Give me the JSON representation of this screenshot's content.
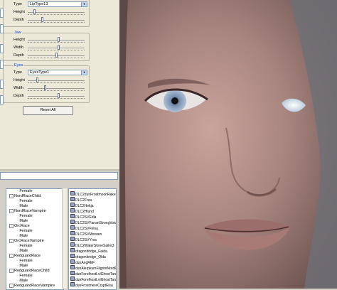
{
  "lips": {
    "type_label": "Type",
    "type_value": "LipType13",
    "height_label": "Height",
    "depth_label": "Depth",
    "height_level": 0.1,
    "depth_level": 0.25
  },
  "jaw": {
    "title": "Jaw",
    "height_label": "Height",
    "width_label": "Width",
    "depth_label": "Depth",
    "height_level": 0.55,
    "width_level": 0.55,
    "depth_level": 0.5
  },
  "eyes": {
    "title": "Eyes",
    "type_label": "Type",
    "type_value": "EyesType1",
    "height_label": "Height",
    "width_label": "Width",
    "depth_label": "Depth",
    "height_level": 0.15,
    "width_level": 0.3,
    "depth_level": 0.55
  },
  "reset_label": "Reset All",
  "tree": [
    {
      "label": "Female",
      "indent": 2,
      "expander": false
    },
    {
      "label": "NordRaceChild",
      "indent": 1,
      "expander": true
    },
    {
      "label": "Female",
      "indent": 2,
      "expander": false
    },
    {
      "label": "Male",
      "indent": 2,
      "expander": false
    },
    {
      "label": "NordRaceVampire",
      "indent": 1,
      "expander": true
    },
    {
      "label": "Female",
      "indent": 2,
      "expander": false
    },
    {
      "label": "Male",
      "indent": 2,
      "expander": false
    },
    {
      "label": "OrcRace",
      "indent": 1,
      "expander": true
    },
    {
      "label": "Female",
      "indent": 2,
      "expander": false
    },
    {
      "label": "Male",
      "indent": 2,
      "expander": false
    },
    {
      "label": "OrcRaceVampire",
      "indent": 1,
      "expander": true
    },
    {
      "label": "Female",
      "indent": 2,
      "expander": false
    },
    {
      "label": "Male",
      "indent": 2,
      "expander": false
    },
    {
      "label": "RedguardRace",
      "indent": 1,
      "expander": true
    },
    {
      "label": "Female",
      "indent": 2,
      "expander": false
    },
    {
      "label": "Male",
      "indent": 2,
      "expander": false
    },
    {
      "label": "RedguardRaceChild",
      "indent": 1,
      "expander": true
    },
    {
      "label": "Female",
      "indent": 2,
      "expander": false
    },
    {
      "label": "Male",
      "indent": 2,
      "expander": false
    },
    {
      "label": "RedguardRaceVampire",
      "indent": 1,
      "expander": true
    }
  ],
  "npc_list": [
    "DLC2dunFrostmoonRakel",
    "DLC2Frea",
    "DLC2Hekja",
    "DLC2Hlund",
    "DLC2SVEdla",
    "DLC2SVFanariStrongVoice",
    "DLC2SVFinna",
    "DLC2SVMorwen",
    "DLC2SVYrsa",
    "DLC2WaterStoneSailor3",
    "dragonbridge_Faida",
    "dragonbridge_Olda",
    "dunAngREF",
    "dunAlerpkumFilgrimNordF",
    "dunForelhostLvlGhostTankF",
    "dunForelhostLvlGhostTankF",
    "dunFrostmereCryptEisa"
  ]
}
